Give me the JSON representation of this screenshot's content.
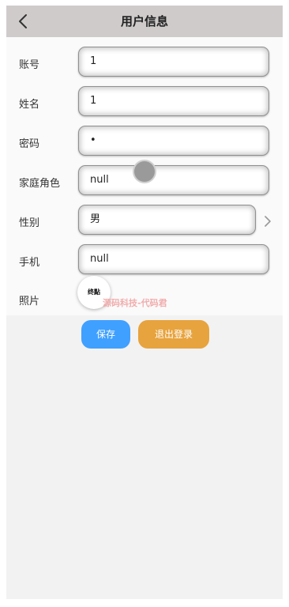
{
  "header": {
    "title": "用户信息"
  },
  "form": {
    "account": {
      "label": "账号",
      "value": "1"
    },
    "name": {
      "label": "姓名",
      "value": "1"
    },
    "password": {
      "label": "密码",
      "value": "•"
    },
    "family_role": {
      "label": "家庭角色",
      "value": "null"
    },
    "gender": {
      "label": "性别",
      "value": "男"
    },
    "phone": {
      "label": "手机",
      "value": "null"
    },
    "photo": {
      "label": "照片",
      "avatar_text": "终點"
    }
  },
  "watermark": "源码科技-代码君",
  "buttons": {
    "save": "保存",
    "logout": "退出登录"
  },
  "colors": {
    "header_bg": "#cfcbcb",
    "save_bg": "#3fa0ff",
    "logout_bg": "#e7a33e"
  },
  "icons": {
    "back": "chevron-left-icon",
    "gender_picker": "chevron-right-icon"
  }
}
